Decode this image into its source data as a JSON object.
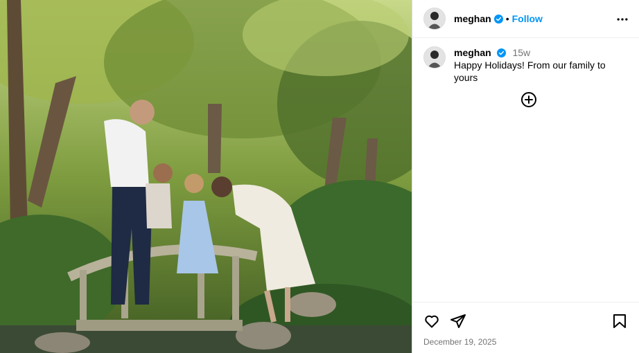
{
  "post": {
    "username": "meghan",
    "follow_label": "Follow",
    "separator": "•",
    "caption": {
      "username": "meghan",
      "time": "15w",
      "text": "Happy Holidays! From our family to yours"
    },
    "date": "December 19, 2025"
  },
  "icons": {
    "verified": "verified-badge-icon",
    "more": "more-options-icon",
    "add_comment": "plus-circle-icon",
    "like": "heart-icon",
    "share": "send-icon",
    "save": "bookmark-icon"
  },
  "colors": {
    "accent": "#0095f6",
    "muted": "#737373",
    "border": "#dbdbdb"
  }
}
